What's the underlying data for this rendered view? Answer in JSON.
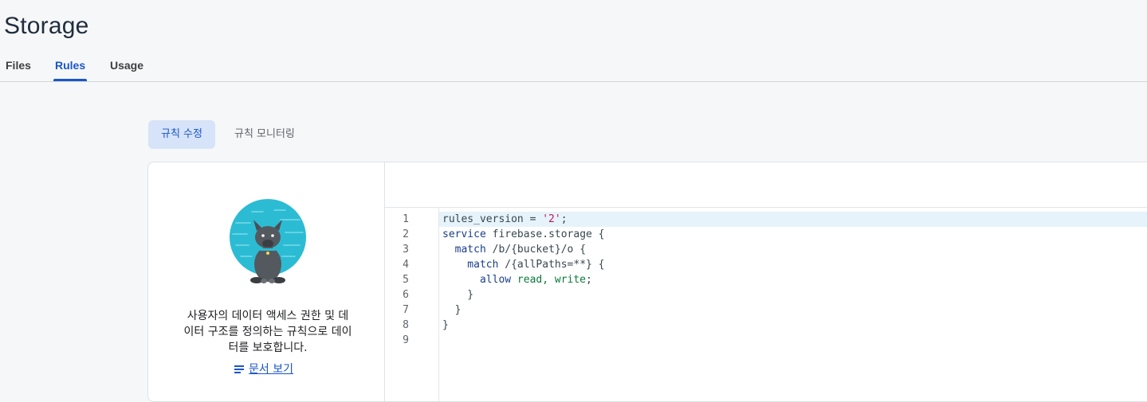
{
  "header": {
    "title": "Storage"
  },
  "tabs": [
    {
      "label": "Files"
    },
    {
      "label": "Rules"
    },
    {
      "label": "Usage"
    }
  ],
  "subtabs": [
    {
      "label": "규칙 수정"
    },
    {
      "label": "규칙 모니터링"
    }
  ],
  "info_panel": {
    "description_lines": [
      "사용자의 데이터 액세스 권한 및 데",
      "이터 구조를 정의하는 규칙으로 데이",
      "터를 보호합니다."
    ],
    "doc_link": "문서 보기",
    "mascot": "firebase-dog-mascot"
  },
  "editor": {
    "line_numbers": [
      "1",
      "2",
      "3",
      "4",
      "5",
      "6",
      "7",
      "8",
      "9"
    ],
    "lines": [
      {
        "a": "rules_version = ",
        "b": "'2'",
        "c": ";"
      },
      {
        "a": "service",
        "b": " firebase.storage {",
        "c": ""
      },
      {
        "a": "  match",
        "b": " /b/{bucket}/o {",
        "c": ""
      },
      {
        "a": "    match",
        "b": " /{allPaths=**} {",
        "c": ""
      },
      {
        "a": "      allow",
        "b": " read, write",
        "c": ";"
      },
      {
        "a": "    }",
        "b": "",
        "c": ""
      },
      {
        "a": "  }",
        "b": "",
        "c": ""
      },
      {
        "a": "}",
        "b": "",
        "c": ""
      },
      {
        "a": "",
        "b": "",
        "c": ""
      }
    ]
  },
  "colors": {
    "accent": "#1a56c9",
    "active_subtab_bg": "#d7e3f8",
    "current_line_bg": "#e6f3fb"
  }
}
